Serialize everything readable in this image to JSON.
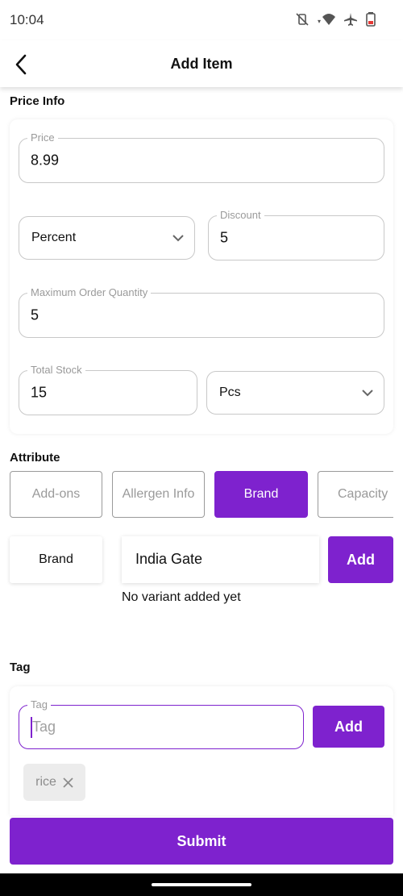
{
  "status_bar": {
    "time": "10:04"
  },
  "app_bar": {
    "title": "Add Item"
  },
  "price_info": {
    "section_title": "Price Info",
    "price": {
      "label": "Price",
      "value": "8.99"
    },
    "discount_type": {
      "value": "Percent"
    },
    "discount": {
      "label": "Discount",
      "value": "5"
    },
    "max_order_qty": {
      "label": "Maximum Order Quantity",
      "value": "5"
    },
    "total_stock": {
      "label": "Total Stock",
      "value": "15"
    },
    "unit": {
      "value": "Pcs"
    }
  },
  "attribute": {
    "section_title": "Attribute",
    "chips": [
      {
        "label": "Add-ons"
      },
      {
        "label": "Allergen Info"
      },
      {
        "label": "Brand",
        "active": true
      },
      {
        "label": "Capacity"
      }
    ],
    "selected_label": "Brand",
    "value_input": "India Gate",
    "add_label": "Add",
    "empty_text": "No variant added yet"
  },
  "tag": {
    "section_title": "Tag",
    "input": {
      "label": "Tag",
      "placeholder": "Tag"
    },
    "add_label": "Add",
    "chips": [
      {
        "label": "rice"
      }
    ]
  },
  "submit_label": "Submit",
  "colors": {
    "primary": "#7e22ce"
  }
}
